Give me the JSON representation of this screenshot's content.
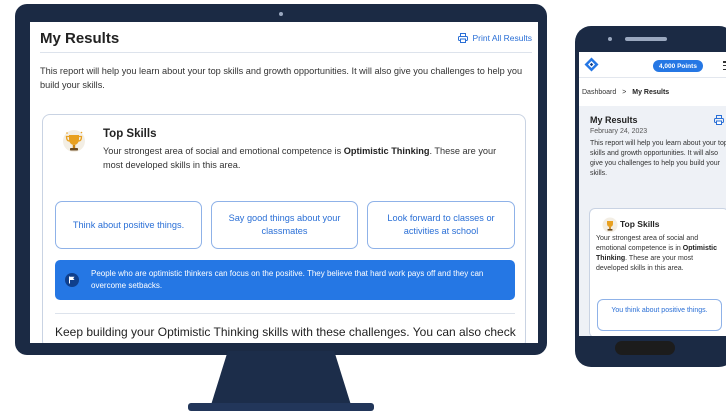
{
  "desktop": {
    "title": "My Results",
    "print_label": "Print All Results",
    "intro": "This report will help you learn about your top skills and growth opportunities. It will also give you challenges to help you build your skills.",
    "card": {
      "heading": "Top Skills",
      "text_before": "Your strongest area of social and emotional competence is ",
      "strength": "Optimistic Thinking",
      "text_after": ". These are your most developed skills in this area.",
      "skills": [
        "Think about positive things.",
        "Say good things about your classmates",
        "Look forward to classes or activities at school"
      ],
      "banner": "People who are optimistic thinkers can focus on the positive. They believe that hard work pays off and they can overcome setbacks.",
      "challenge_text": "Keep building your Optimistic Thinking skills with these challenges. You can also check out more challenges below for other areas."
    }
  },
  "mobile": {
    "points": "4,000 Points",
    "breadcrumb": {
      "root": "Dashboard",
      "separator": ">",
      "current": "My Results"
    },
    "title": "My Results",
    "date": "February 24, 2023",
    "intro": "This report will help you learn about your top skills and growth opportunities. It will also give you challenges to help you build your skills.",
    "card": {
      "heading": "Top Skills",
      "text_before": "Your strongest area of social and emotional competence is in ",
      "strength": "Optimistic Thinking",
      "text_after": ". These are your most developed skills in this area.",
      "first_skill": "You think about positive things."
    }
  },
  "colors": {
    "accent": "#2577e4",
    "link": "#2a6fd6",
    "device_frame": "#1b2a44",
    "trophy": "#e8a020"
  },
  "icons": {
    "print": "printer-icon",
    "trophy": "trophy-icon",
    "flag": "flag-icon",
    "logo": "diamond-logo-icon",
    "menu": "hamburger-menu-icon"
  }
}
